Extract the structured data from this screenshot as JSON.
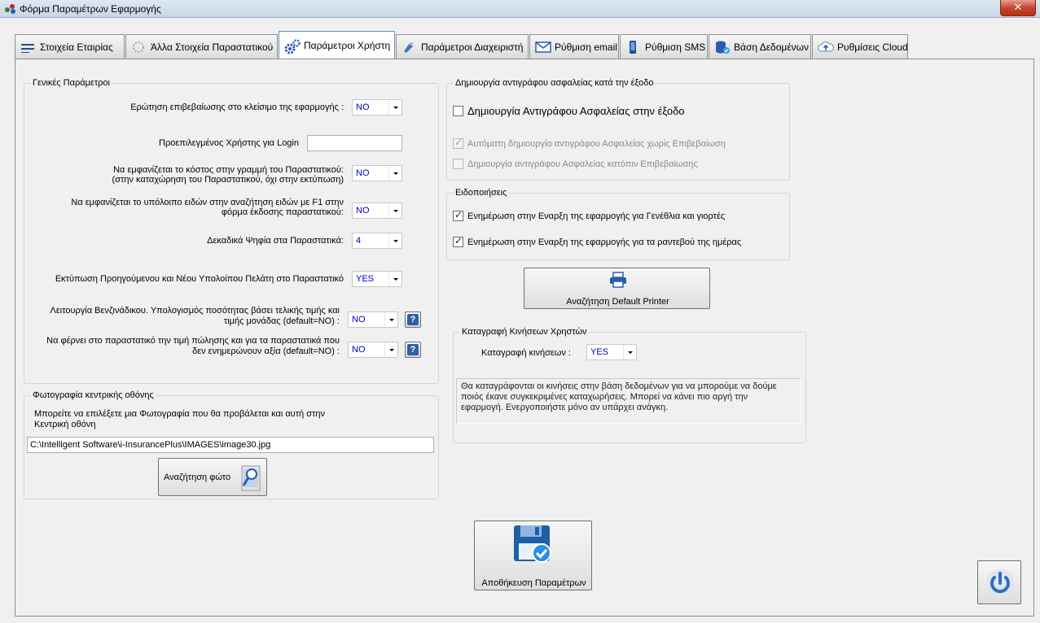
{
  "window": {
    "title": "Φόρμα Παραμέτρων Εφαρμογής",
    "close_label": "✕"
  },
  "tabs": [
    {
      "label": "Στοιχεία Εταιρίας",
      "icon": "company-info-icon"
    },
    {
      "label": "Άλλα Στοιχεία Παραστατικού",
      "icon": "document-settings-icon"
    },
    {
      "label": "Παράμετροι Χρήστη",
      "icon": "gears-icon",
      "active": true
    },
    {
      "label": "Παράμετροι Διαχειριστή",
      "icon": "admin-icon"
    },
    {
      "label": "Ρύθμιση email",
      "icon": "email-icon"
    },
    {
      "label": "Ρύθμιση SMS",
      "icon": "phone-icon"
    },
    {
      "label": "Βάση Δεδομένων",
      "icon": "database-icon"
    },
    {
      "label": "Ρυθμίσεις Cloud",
      "icon": "cloud-upload-icon"
    }
  ],
  "general": {
    "title": "Γενικές Παράμετροι",
    "confirm_close": {
      "label": "Ερώτηση επιβεβαίωσης στο κλείσιμο της εφαρμογής :",
      "value": "NO"
    },
    "default_user": {
      "label": "Προεπιλεγμένος Χρήστης για Login",
      "value": ""
    },
    "show_cost": {
      "label_1": "Να εμφανίζεται το κόστος στην γραμμή  του Παραστατικού:",
      "label_2": "(στην καταχώρηση του Παραστατικού, όχι στην εκτύπωση)",
      "value": "NO"
    },
    "show_stock": {
      "label_1": "Να εμφανίζεται το υπόλοιπο ειδών στην αναζήτηση ειδών με F1 στην",
      "label_2": "φόρμα έκδοσης παραστατικού:",
      "value": "NO"
    },
    "decimals": {
      "label": "Δεκαδικά Ψηφία στα Παραστατικά:",
      "value": "4"
    },
    "print_balance": {
      "label": "Εκτύπωση Προηγούμενου και Νέου Υπολοίπου Πελάτη στο Παραστατικό",
      "value": "YES"
    },
    "gas_station": {
      "label_1": "Λειτουργία Βενζινάδικου. Υπολογισμός ποσότητας βάσει τελικής τιμής και",
      "label_2": "τιμής μονάδας (default=NO) :",
      "value": "NO",
      "help": "?"
    },
    "sale_price": {
      "label_1": "Να φέρνει στο παραστατικό την τιμή πώλησης και για τα παραστατικά που",
      "label_2": "δεν ενημερώνουν αξία (default=NO) :",
      "value": "NO",
      "help": "?"
    }
  },
  "photo": {
    "title": "Φωτογραφία κεντρικής οθόνης",
    "description_1": "Μπορείτε να επιλέξετε μια Φωτογραφία που θα προβάλεται και αυτή στην",
    "description_2": "Κεντρική οθόνη",
    "path": "C:\\Intelligent Software\\i-InsurancePlus\\IMAGES\\image30.jpg",
    "search_button": "Αναζήτηση φώτο"
  },
  "backup": {
    "title": "Δημιουργία αντιγράφου ασφαλείας κατά την έξοδο",
    "create_on_exit": {
      "label": "Δημιουργία Αντιγράφου Ασφαλείας στην έξοδο",
      "checked": false
    },
    "auto_no_confirm": {
      "label": "Αυτόματη δημιουργία αντιγράφου Ασφαλείας χωρίς Επιβεβαίωση",
      "checked": true
    },
    "after_confirm": {
      "label": "Δημιουργία αντιγράφου Ασφαλείας κατόπιν Επιβεβαίωσης",
      "checked": false
    }
  },
  "notifications": {
    "title": "Ειδοποιήσεις",
    "birthdays": {
      "label": "Ενημέρωση στην Εναρξη της εφαρμογής για Γενέθλια και γιορτές",
      "checked": true
    },
    "appointments": {
      "label": "Ενημέρωση στην Εναρξη της εφαρμογής για τα ραντεβού της ημέρας",
      "checked": true
    }
  },
  "printer_button": "Αναζήτηση Default Printer",
  "user_log": {
    "title": "Καταγραφή Κινήσεων Χρηστών",
    "label": "Καταγραφή κινήσεων   :",
    "value": "YES",
    "info_1": "Θα καταγράφονται οι κινήσεις στην βάση δεδομένων για να μπορούμε να δούμε",
    "info_2": "ποιός έκανε συγκεκριμένες καταχωρήσεις. Μπορεί να κάνει πιο αργή την",
    "info_3": "εφαρμογή. Ενεργοποιήστε μόνο αν υπάρχει ανάγκη."
  },
  "save_button": "Αποθήκευση Παραμέτρων",
  "colors": {
    "accent": "#2f6fc0",
    "combo_text": "#0000c0"
  }
}
